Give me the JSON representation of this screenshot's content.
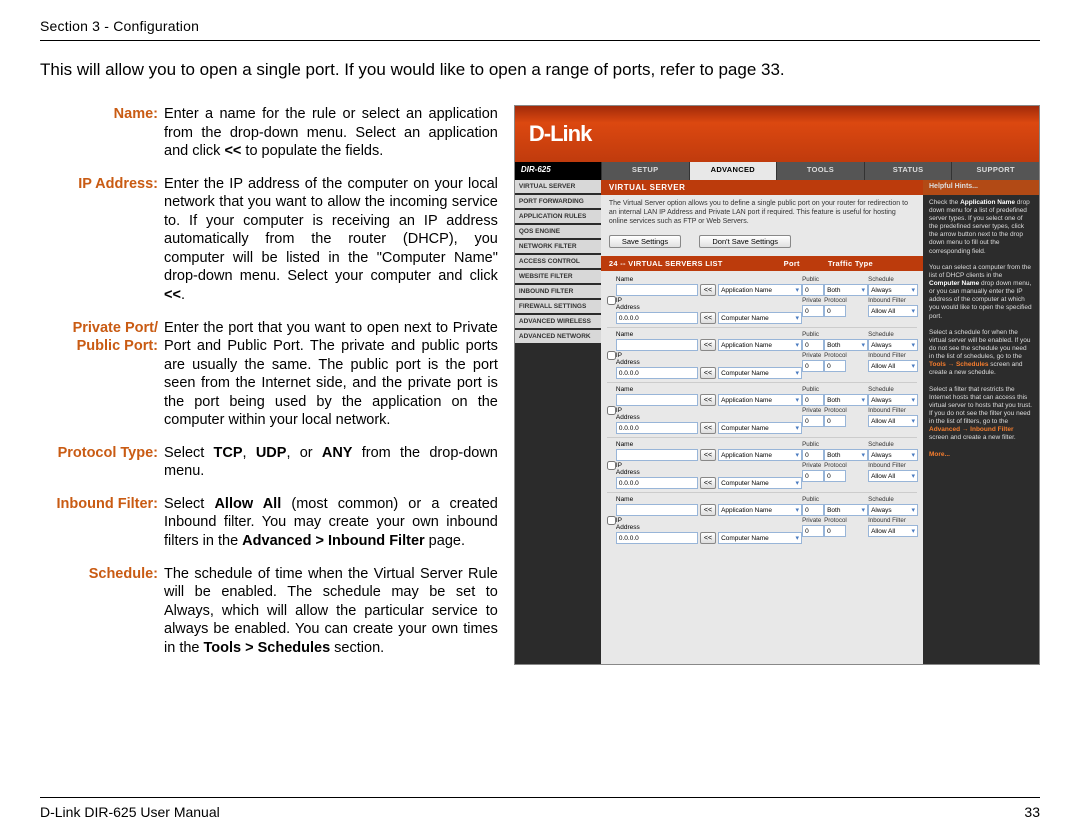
{
  "header": "Section 3 - Configuration",
  "intro": "This will allow you to open a single port. If you would like to open a range of ports, refer to page 33.",
  "defs": [
    {
      "label": "Name:",
      "body": "Enter a name for the rule or select an application from the drop-down menu. Select an application and click <b>&lt;&lt;</b> to populate the fields."
    },
    {
      "label": "IP Address:",
      "body": "Enter the IP address of the computer on your local network that you want to allow the incoming service to. If your computer is receiving an IP address automatically from the router (DHCP), you computer will be listed in the \"Computer Name\" drop-down menu. Select your computer and click <b>&lt;&lt;</b>."
    },
    {
      "label": "Private Port/<br>Public Port:",
      "body": "Enter the port that you want to open next to Private Port and Public Port. The private and public ports are usually the same. The public port is the port seen from the Internet side, and the private port is the port being used by the application on the computer within your local network."
    },
    {
      "label": "Protocol Type:",
      "body": "Select <b>TCP</b>, <b>UDP</b>, or <b>ANY</b> from the drop-down menu."
    },
    {
      "label": "Inbound Filter:",
      "body": "Select <b>Allow All</b> (most common) or a created Inbound filter. You may create your own inbound filters in the <b>Advanced &gt; Inbound Filter</b> page."
    },
    {
      "label": "Schedule:",
      "body": "The schedule of time when the Virtual Server Rule will be enabled. The schedule may be set to Always, which will allow the particular service to always be enabled. You can create your own times in the <b>Tools &gt; Schedules</b> section."
    }
  ],
  "shot": {
    "brand": "D-Link",
    "model": "DIR-625",
    "tabs": [
      "SETUP",
      "ADVANCED",
      "TOOLS",
      "STATUS",
      "SUPPORT"
    ],
    "tab_active": 1,
    "sidebar": [
      "VIRTUAL SERVER",
      "PORT FORWARDING",
      "APPLICATION RULES",
      "QOS ENGINE",
      "NETWORK FILTER",
      "ACCESS CONTROL",
      "WEBSITE FILTER",
      "INBOUND FILTER",
      "FIREWALL SETTINGS",
      "ADVANCED WIRELESS",
      "ADVANCED NETWORK"
    ],
    "main_title": "VIRTUAL SERVER",
    "main_desc": "The Virtual Server option allows you to define a single public port on your router for redirection to an internal LAN IP Address and Private LAN port if required. This feature is useful for hosting online services such as FTP or Web Servers.",
    "btn_save": "Save Settings",
    "btn_dont": "Don't Save Settings",
    "list_title": "24 -- VIRTUAL SERVERS LIST",
    "col_port": "Port",
    "col_traf": "Traffic Type",
    "labels": {
      "name": "Name",
      "ip": "IP Address",
      "appname": "Application Name",
      "compname": "Computer Name",
      "public": "Public",
      "private": "Private",
      "schedule": "Schedule",
      "inbound": "Inbound Filter",
      "protocol": "Protocol"
    },
    "ip_default": "0.0.0.0",
    "port_default": "0",
    "arrow_btn": "<<",
    "sel_both": "Both",
    "sel_always": "Always",
    "sel_allow": "Allow All",
    "hints_title": "Helpful Hints...",
    "hints_body": "Check the <b>Application Name</b> drop down menu for a list of predefined server types. If you select one of the predefined server types, click the arrow button next to the drop down menu to fill out the corresponding field.<br><br>You can select a computer from the list of DHCP clients in the <b>Computer Name</b> drop down menu, or you can manually enter the IP address of the computer at which you would like to open the specified port.<br><br>Select a schedule for when the virtual server will be enabled. If you do not see the schedule you need in the list of schedules, go to the <span class='orange'>Tools → Schedules</span> screen and create a new schedule.<br><br>Select a filter that restricts the Internet hosts that can access this virtual server to hosts that you trust. If you do not see the filter you need in the list of filters, go to the <span class='orange'>Advanced → Inbound Filter</span> screen and create a new filter.<br><br><span class='orange'>More...</span>"
  },
  "footer_left": "D-Link DIR-625 User Manual",
  "footer_right": "33"
}
